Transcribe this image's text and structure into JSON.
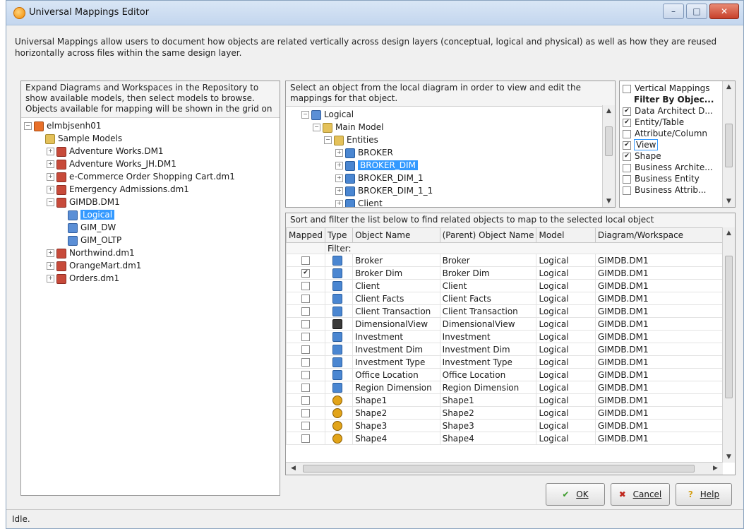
{
  "window": {
    "title": "Universal Mappings Editor",
    "min_label": "–",
    "max_label": "□",
    "close_label": "✕"
  },
  "description": "Universal Mappings allow users to document how objects are related vertically across design layers (conceptual, logical and physical) as well as how they are reused horizontally across files within the same design layer.",
  "repo_panel": {
    "instructions": "Expand Diagrams and Workspaces in the Repository to show available models, then select models to browse. Objects available for mapping will be shown in the grid on",
    "tree": [
      {
        "label": "elmbjsenh01",
        "icon": "db",
        "indent": 0,
        "expander": "−"
      },
      {
        "label": "Sample Models",
        "icon": "folder",
        "indent": 1,
        "expander": ""
      },
      {
        "label": "Adventure Works.DM1",
        "icon": "model",
        "indent": 2,
        "expander": "+"
      },
      {
        "label": "Adventure Works_JH.DM1",
        "icon": "model",
        "indent": 2,
        "expander": "+"
      },
      {
        "label": "e-Commerce Order Shopping Cart.dm1",
        "icon": "model",
        "indent": 2,
        "expander": "+"
      },
      {
        "label": "Emergency Admissions.dm1",
        "icon": "model",
        "indent": 2,
        "expander": "+"
      },
      {
        "label": "GIMDB.DM1",
        "icon": "model",
        "indent": 2,
        "expander": "−"
      },
      {
        "label": "Logical",
        "icon": "layer",
        "indent": 3,
        "expander": "",
        "selected": true
      },
      {
        "label": "GIM_DW",
        "icon": "layer",
        "indent": 3,
        "expander": ""
      },
      {
        "label": "GIM_OLTP",
        "icon": "layer",
        "indent": 3,
        "expander": ""
      },
      {
        "label": "Northwind.dm1",
        "icon": "model",
        "indent": 2,
        "expander": "+"
      },
      {
        "label": "OrangeMart.dm1",
        "icon": "model",
        "indent": 2,
        "expander": "+"
      },
      {
        "label": "Orders.dm1",
        "icon": "model",
        "indent": 2,
        "expander": "+"
      }
    ]
  },
  "local_panel": {
    "instructions": "Select an object from the local diagram in order to view and edit the mappings for that object.",
    "tree": [
      {
        "label": "Logical",
        "icon": "layer",
        "indent": 0,
        "expander": "−"
      },
      {
        "label": "Main Model",
        "icon": "folder",
        "indent": 1,
        "expander": "−"
      },
      {
        "label": "Entities",
        "icon": "folder",
        "indent": 2,
        "expander": "−"
      },
      {
        "label": "BROKER",
        "icon": "tbl",
        "indent": 3,
        "expander": "+"
      },
      {
        "label": "BROKER_DIM",
        "icon": "tbl",
        "indent": 3,
        "expander": "+",
        "selected": true
      },
      {
        "label": "BROKER_DIM_1",
        "icon": "tbl",
        "indent": 3,
        "expander": "+"
      },
      {
        "label": "BROKER_DIM_1_1",
        "icon": "tbl",
        "indent": 3,
        "expander": "+"
      },
      {
        "label": "Client",
        "icon": "tbl",
        "indent": 3,
        "expander": "+"
      }
    ]
  },
  "filter_panel": {
    "items": [
      {
        "label": "Vertical Mappings",
        "checked": false,
        "bold": false
      },
      {
        "label": "Filter By Objec...",
        "checked": null,
        "bold": true
      },
      {
        "label": "Data Architect D...",
        "checked": true,
        "bold": false
      },
      {
        "label": "Entity/Table",
        "checked": true,
        "bold": false
      },
      {
        "label": "Attribute/Column",
        "checked": false,
        "bold": false
      },
      {
        "label": "View",
        "checked": true,
        "bold": false,
        "focused": true
      },
      {
        "label": "Shape",
        "checked": true,
        "bold": false
      },
      {
        "label": "Business Archite...",
        "checked": false,
        "bold": false
      },
      {
        "label": "Business Entity",
        "checked": false,
        "bold": false
      },
      {
        "label": "Business Attrib...",
        "checked": false,
        "bold": false
      }
    ]
  },
  "grid_panel": {
    "instructions": "Sort and filter the list below to find related objects to map to the selected local object",
    "columns": [
      "Mapped",
      "Type",
      "Object Name",
      "(Parent) Object Name",
      "Model",
      "Diagram/Workspace"
    ],
    "filter_label": "Filter:",
    "rows": [
      {
        "mapped": false,
        "icon": "tbl",
        "name": "Broker",
        "parent": "Broker",
        "model": "Logical",
        "diagram": "GIMDB.DM1"
      },
      {
        "mapped": true,
        "icon": "tbl",
        "name": "Broker Dim",
        "parent": "Broker Dim",
        "model": "Logical",
        "diagram": "GIMDB.DM1"
      },
      {
        "mapped": false,
        "icon": "tbl",
        "name": "Client",
        "parent": "Client",
        "model": "Logical",
        "diagram": "GIMDB.DM1"
      },
      {
        "mapped": false,
        "icon": "tbl",
        "name": "Client Facts",
        "parent": "Client Facts",
        "model": "Logical",
        "diagram": "GIMDB.DM1"
      },
      {
        "mapped": false,
        "icon": "tbl",
        "name": "Client Transaction",
        "parent": "Client Transaction",
        "model": "Logical",
        "diagram": "GIMDB.DM1"
      },
      {
        "mapped": false,
        "icon": "view",
        "name": "DimensionalView",
        "parent": "DimensionalView",
        "model": "Logical",
        "diagram": "GIMDB.DM1"
      },
      {
        "mapped": false,
        "icon": "tbl",
        "name": "Investment",
        "parent": "Investment",
        "model": "Logical",
        "diagram": "GIMDB.DM1"
      },
      {
        "mapped": false,
        "icon": "tbl",
        "name": "Investment Dim",
        "parent": "Investment Dim",
        "model": "Logical",
        "diagram": "GIMDB.DM1"
      },
      {
        "mapped": false,
        "icon": "tbl",
        "name": "Investment Type",
        "parent": "Investment Type",
        "model": "Logical",
        "diagram": "GIMDB.DM1"
      },
      {
        "mapped": false,
        "icon": "tbl",
        "name": "Office Location",
        "parent": "Office Location",
        "model": "Logical",
        "diagram": "GIMDB.DM1"
      },
      {
        "mapped": false,
        "icon": "tbl",
        "name": "Region Dimension",
        "parent": "Region Dimension",
        "model": "Logical",
        "diagram": "GIMDB.DM1"
      },
      {
        "mapped": false,
        "icon": "shape",
        "name": "Shape1",
        "parent": "Shape1",
        "model": "Logical",
        "diagram": "GIMDB.DM1"
      },
      {
        "mapped": false,
        "icon": "shape",
        "name": "Shape2",
        "parent": "Shape2",
        "model": "Logical",
        "diagram": "GIMDB.DM1"
      },
      {
        "mapped": false,
        "icon": "shape",
        "name": "Shape3",
        "parent": "Shape3",
        "model": "Logical",
        "diagram": "GIMDB.DM1"
      },
      {
        "mapped": false,
        "icon": "shape",
        "name": "Shape4",
        "parent": "Shape4",
        "model": "Logical",
        "diagram": "GIMDB.DM1"
      }
    ]
  },
  "buttons": {
    "ok": "OK",
    "cancel": "Cancel",
    "help": "Help"
  },
  "status": "Idle."
}
